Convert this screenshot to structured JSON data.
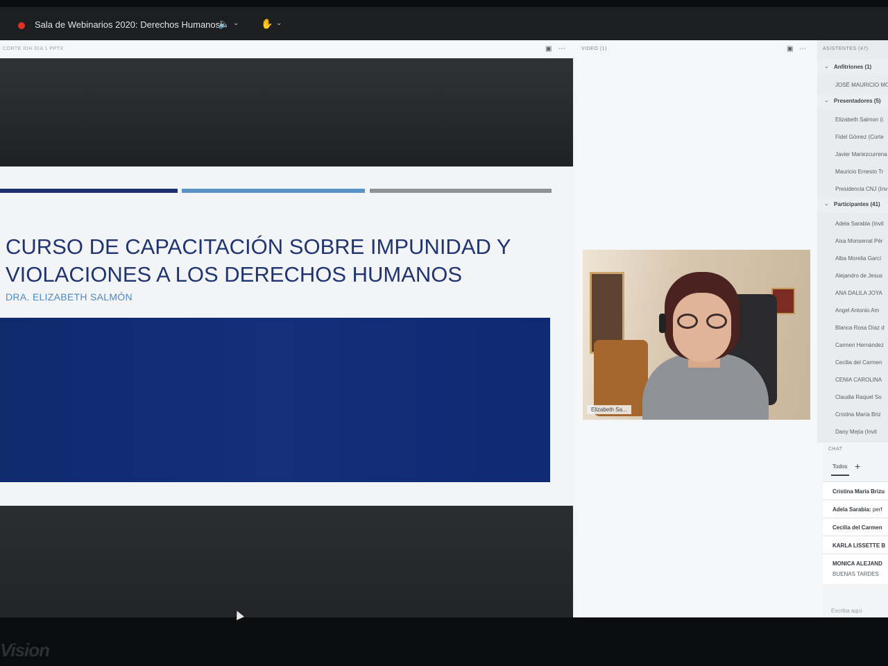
{
  "app": {
    "room_title": "Sala de Webinarios 2020: Derechos Humanos"
  },
  "share_pod": {
    "title": "CORTE IDH DIA 1 PPTX",
    "slide": {
      "title_line1": "CURSO DE CAPACITACIÓN SOBRE IMPUNIDAD Y",
      "title_line2": "VIOLACIONES A LOS DERECHOS HUMANOS",
      "subtitle": "DRA. ELIZABETH SALMÓN"
    }
  },
  "video_pod": {
    "title": "VIDEO (1)",
    "speaker_label": "Elizabeth Sa..."
  },
  "attendees": {
    "title": "ASISTENTES (47)",
    "groups": [
      {
        "label": "Anfitriones (1)",
        "members": [
          "JOSÉ MAURICIO MO"
        ]
      },
      {
        "label": "Presentadores (5)",
        "members": [
          "Elizabeth Salmon (i",
          "Fidel Gómez (Corte",
          "Javier Mariezcurrena",
          "Mauricio Ernesto Tr",
          "Presidencia CNJ (Inv"
        ]
      },
      {
        "label": "Participantes (41)",
        "members": [
          "Adela Sarabia (Invit",
          "Aixa Monserrat Pér",
          "Alba Morelia Garcí",
          "Alejandro de Jesus",
          "ANA DALILA JOYA",
          "Angel Antonio Am",
          "Blanca Rosa Díaz d",
          "Carmen Hernández",
          "Cecilia del Carmen",
          "CENIA CAROLINA",
          "Claudia Raquel So",
          "Cristina María Briz",
          "Dany Mejía (Invit"
        ]
      }
    ]
  },
  "chat": {
    "title": "CHAT",
    "tab_label": "Todos",
    "add_label": "+",
    "messages": [
      {
        "sender": "Cristina María Brizu",
        "text": ""
      },
      {
        "sender": "Adela Sarabia:",
        "text": "perf"
      },
      {
        "sender": "Cecilia del Carmen",
        "text": ""
      },
      {
        "sender": "KARLA LISSETTE B",
        "text": ""
      },
      {
        "sender": "MONICA ALEJAND",
        "text": "BUENAS TARDES"
      }
    ],
    "input_placeholder": "Escriba aquí"
  },
  "monitor": {
    "brand": "Vision"
  }
}
